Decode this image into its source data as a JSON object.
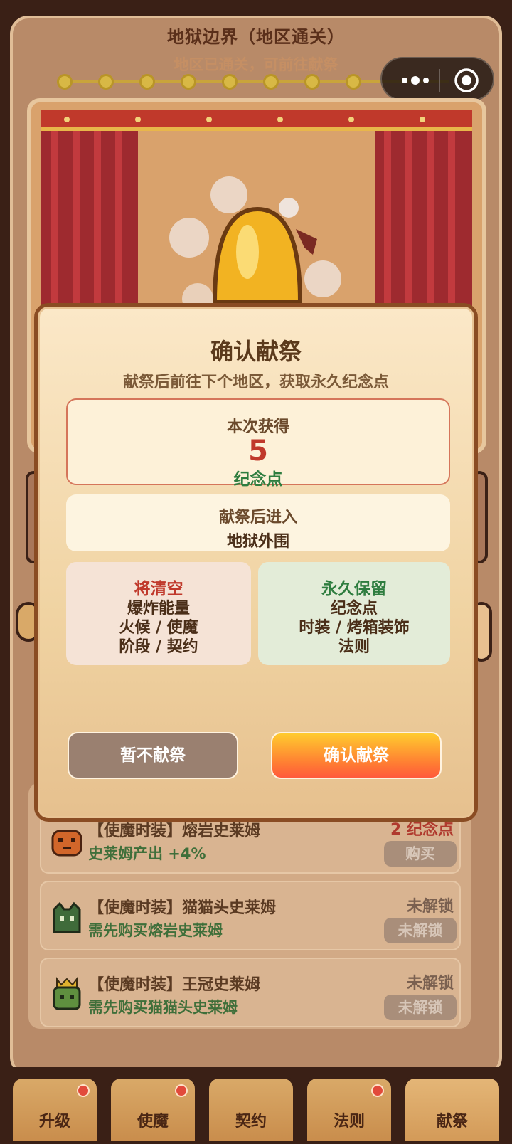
{
  "header": {
    "region_title": "地狱边界（地区通关）",
    "region_subtitle": "地区已通关，可前往献祭"
  },
  "modal": {
    "title": "确认献祭",
    "description": "献祭后前往下个地区，获取永久纪念点",
    "reward_label": "本次获得",
    "reward_value": "5",
    "reward_unit": "纪念点",
    "next_label": "献祭后进入",
    "next_region": "地狱外围",
    "clear_title": "将清空",
    "clear_lines": [
      "爆炸能量",
      "火候 / 使魔",
      "阶段 / 契约"
    ],
    "keep_title": "永久保留",
    "keep_lines": [
      "纪念点",
      "时装 / 烤箱装饰",
      "法则"
    ],
    "cancel_label": "暂不献祭",
    "confirm_label": "确认献祭"
  },
  "shop": {
    "items": [
      {
        "name": "【使魔时装】熔岩史莱姆",
        "desc": "史莱姆产出 +4%",
        "cost": "2 纪念点",
        "button": "购买"
      },
      {
        "name": "【使魔时装】猫猫头史莱姆",
        "desc": "需先购买熔岩史莱姆",
        "cost": "未解锁",
        "button": "未解锁"
      },
      {
        "name": "【使魔时装】王冠史莱姆",
        "desc": "需先购买猫猫头史莱姆",
        "cost": "未解锁",
        "button": "未解锁"
      }
    ]
  },
  "tabs": [
    {
      "label": "升级",
      "badge": true
    },
    {
      "label": "使魔",
      "badge": true
    },
    {
      "label": "契约",
      "badge": false
    },
    {
      "label": "法则",
      "badge": true
    },
    {
      "label": "献祭",
      "badge": false
    }
  ],
  "colors": {
    "accent_red": "#c0392b",
    "accent_green": "#2e7d3f",
    "confirm_button": "#ff7a33"
  }
}
